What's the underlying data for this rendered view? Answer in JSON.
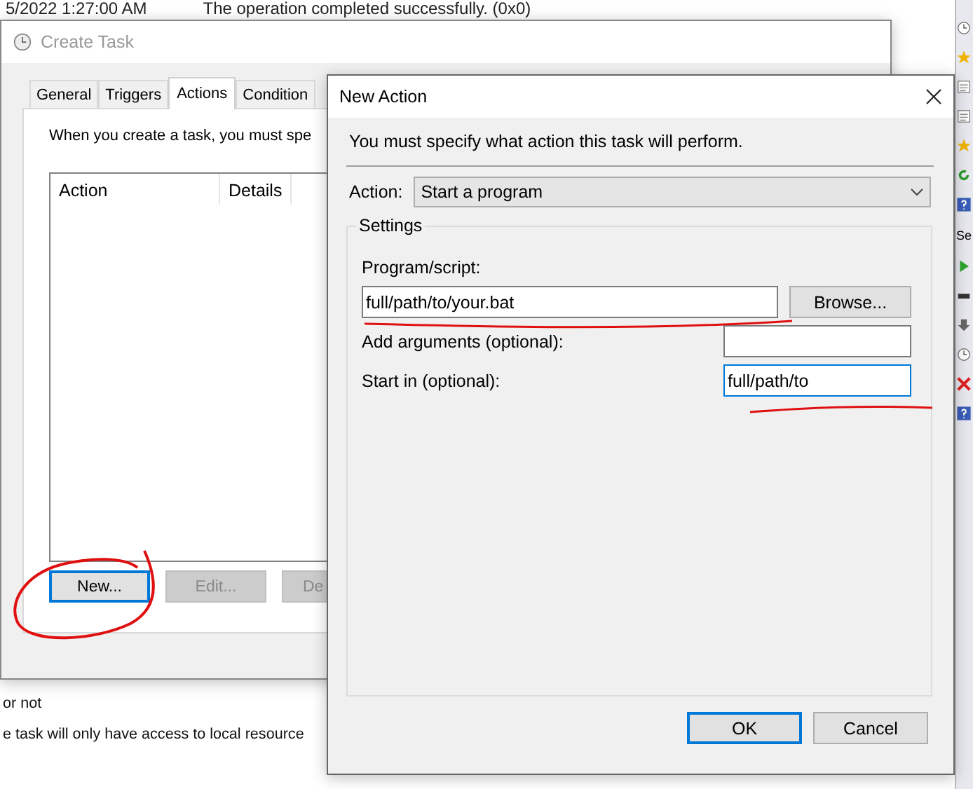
{
  "background": {
    "log_row": {
      "time": "5/2022 1:27:00 AM",
      "result": "The operation completed successfully. (0x0)"
    },
    "notes": [
      "or not",
      "e task will only have access to local resource"
    ],
    "side_label": "Se"
  },
  "create_task": {
    "title": "Create Task",
    "tabs": [
      {
        "label": "General",
        "selected": false
      },
      {
        "label": "Triggers",
        "selected": false
      },
      {
        "label": "Actions",
        "selected": true
      },
      {
        "label": "Condition",
        "selected": false
      }
    ],
    "intro": "When you create a task, you must spe",
    "columns": [
      "Action",
      "Details"
    ],
    "buttons": [
      {
        "label": "New...",
        "disabled": false,
        "focused": true
      },
      {
        "label": "Edit...",
        "disabled": true,
        "focused": false
      },
      {
        "label": "De",
        "disabled": true,
        "focused": false
      }
    ]
  },
  "new_action": {
    "title": "New Action",
    "intro": "You must specify what action this task will perform.",
    "action_label": "Action:",
    "action_value": "Start a program",
    "group_title": "Settings",
    "program": {
      "label": "Program/script:",
      "value": "full/path/to/your.bat",
      "focused": false
    },
    "browse": "Browse...",
    "fields": [
      {
        "label": "Add arguments (optional):",
        "focused": false
      },
      {
        "label": "Start in (optional):",
        "value": "full/path/to",
        "focused": true
      }
    ],
    "buttons": [
      {
        "label": "OK",
        "focused": true
      },
      {
        "label": "Cancel",
        "focused": false
      }
    ]
  }
}
